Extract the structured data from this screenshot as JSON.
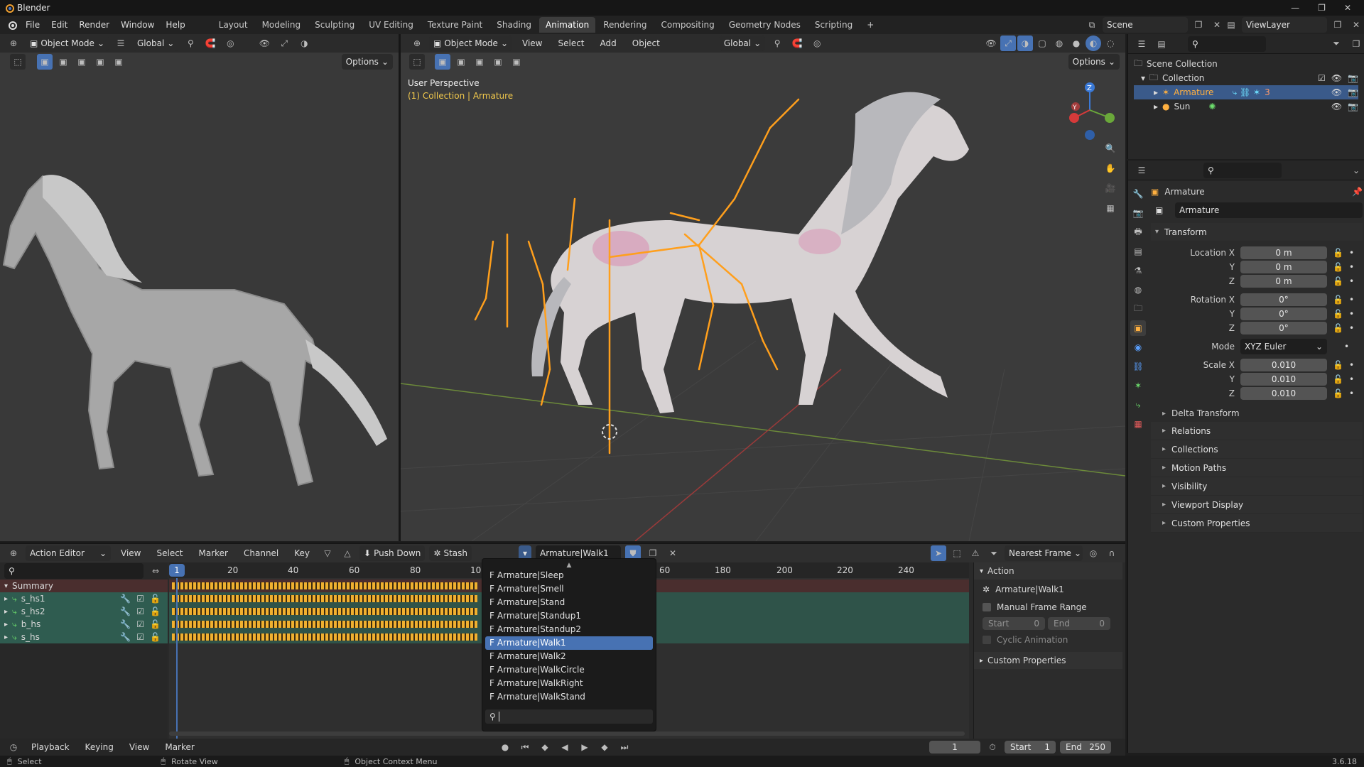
{
  "app": {
    "title": "Blender",
    "version": "3.6.18"
  },
  "menus": [
    "File",
    "Edit",
    "Render",
    "Window",
    "Help"
  ],
  "workspaces": [
    "Layout",
    "Modeling",
    "Sculpting",
    "UV Editing",
    "Texture Paint",
    "Shading",
    "Animation",
    "Rendering",
    "Compositing",
    "Geometry Nodes",
    "Scripting"
  ],
  "active_workspace": "Animation",
  "scene": {
    "name": "Scene",
    "view_layer": "ViewLayer"
  },
  "left_viewport": {
    "mode": "Object Mode",
    "orientation": "Global",
    "options": "Options"
  },
  "main_viewport": {
    "mode": "Object Mode",
    "menus": [
      "View",
      "Select",
      "Add",
      "Object"
    ],
    "orientation": "Global",
    "options": "Options",
    "overlay_title": "User Perspective",
    "overlay_sub": "(1) Collection | Armature"
  },
  "outliner": {
    "scene_collection": "Scene Collection",
    "collection": "Collection",
    "items": [
      {
        "name": "Armature"
      },
      {
        "name": "Sun"
      }
    ],
    "badge": "3"
  },
  "properties": {
    "object_name": "Armature",
    "data_name": "Armature",
    "transform_label": "Transform",
    "location_label": "Location X",
    "location": [
      "0 m",
      "0 m",
      "0 m"
    ],
    "rotation_label": "Rotation X",
    "rotation": [
      "0°",
      "0°",
      "0°"
    ],
    "mode_label": "Mode",
    "mode_value": "XYZ Euler",
    "scale_label": "Scale X",
    "scale": [
      "0.010",
      "0.010",
      "0.010"
    ],
    "axis_y": "Y",
    "axis_z": "Z",
    "delta": "Delta Transform",
    "sections": [
      "Relations",
      "Collections",
      "Motion Paths",
      "Visibility",
      "Viewport Display",
      "Custom Properties"
    ]
  },
  "action_editor": {
    "mode": "Action Editor",
    "menus": [
      "View",
      "Select",
      "Marker",
      "Channel",
      "Key"
    ],
    "push_down": "Push Down",
    "stash": "Stash",
    "action": "Armature|Walk1",
    "snap": "Nearest Frame",
    "ruler": [
      "1",
      "20",
      "40",
      "60",
      "80",
      "10",
      "60",
      "180",
      "200",
      "220",
      "240"
    ],
    "current_frame_label": "1",
    "summary": "Summary",
    "channels": [
      "s_hs1",
      "s_hs2",
      "b_hs",
      "s_hs"
    ]
  },
  "dropdown": {
    "items": [
      "Armature|Sleep",
      "Armature|Smell",
      "Armature|Stand",
      "Armature|Standup1",
      "Armature|Standup2",
      "Armature|Walk1",
      "Armature|Walk2",
      "Armature|WalkCircle",
      "Armature|WalkRight",
      "Armature|WalkStand"
    ],
    "selected_index": 5,
    "prefix": "F"
  },
  "action_panel": {
    "header": "Action",
    "name": "Armature|Walk1",
    "manual_range": "Manual Frame Range",
    "start_label": "Start",
    "start": "0",
    "end_label": "End",
    "end": "0",
    "cyclic": "Cyclic Animation",
    "custom": "Custom Properties"
  },
  "timeline": {
    "menus": [
      "Playback",
      "Keying",
      "View",
      "Marker"
    ],
    "frame": "1",
    "start_label": "Start",
    "start": "1",
    "end_label": "End",
    "end": "250"
  },
  "statusbar": {
    "select": "Select",
    "rotate": "Rotate View",
    "context": "Object Context Menu"
  }
}
